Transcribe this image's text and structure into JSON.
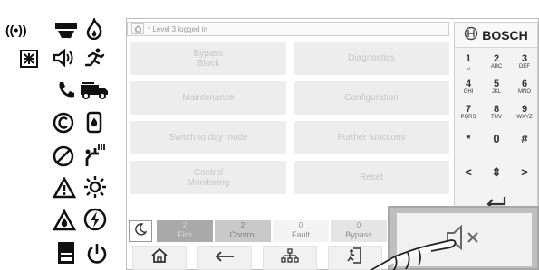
{
  "status_bar": {
    "text": "* Level 3 logged in"
  },
  "function_buttons": [
    {
      "label": "Bypass\nBlock",
      "name": "bypass-block-button"
    },
    {
      "label": "Diagnostics",
      "name": "diagnostics-button"
    },
    {
      "label": "Maintenance",
      "name": "maintenance-button"
    },
    {
      "label": "Configuration",
      "name": "configuration-button"
    },
    {
      "label": "Switch to day mode",
      "name": "switch-day-mode-button"
    },
    {
      "label": "Further functions",
      "name": "further-functions-button"
    },
    {
      "label": "Control\nMonitoring",
      "name": "control-monitoring-button"
    },
    {
      "label": "Reset",
      "name": "reset-button"
    }
  ],
  "brand": {
    "name": "BOSCH"
  },
  "keypad": {
    "keys": [
      {
        "digit": "1",
        "letters": "␣"
      },
      {
        "digit": "2",
        "letters": "ABC"
      },
      {
        "digit": "3",
        "letters": "DEF"
      },
      {
        "digit": "4",
        "letters": "GHI"
      },
      {
        "digit": "5",
        "letters": "JKL"
      },
      {
        "digit": "6",
        "letters": "MNO"
      },
      {
        "digit": "7",
        "letters": "PQRS"
      },
      {
        "digit": "8",
        "letters": "TUV"
      },
      {
        "digit": "9",
        "letters": "WXYZ"
      },
      {
        "digit": "*",
        "letters": ""
      },
      {
        "digit": "0",
        "letters": ""
      },
      {
        "digit": "#",
        "letters": ""
      }
    ],
    "nav": {
      "left": "<",
      "updown": "⇕",
      "right": ">"
    }
  },
  "tabs": {
    "fire": {
      "count": "2",
      "label": "Fire"
    },
    "control": {
      "count": "2",
      "label": "Control"
    },
    "fault": {
      "count": "0",
      "label": "Fault"
    },
    "bypass": {
      "count": "0",
      "label": "Bypass"
    }
  },
  "icons": {
    "indicators": [
      "radio-transmission-icon",
      "flashing-siren-icon",
      "fire-flame-icon",
      "alarm-box-icon",
      "speaker-icon",
      "running-person-icon",
      "phone-icon",
      "fire-truck-icon",
      "copyright-c-icon",
      "extinguisher-icon",
      "prohibited-icon",
      "sprinkler-icon",
      "warning-triangle-icon",
      "sun-icon",
      "fire-warning-triangle-icon",
      "lightning-icon",
      "printer-icon",
      "power-icon"
    ],
    "bottom_nav": [
      "home-icon",
      "back-arrow-icon",
      "network-icon",
      "logout-icon"
    ],
    "mute": "speaker-mute-icon"
  },
  "colors": {
    "accent": "#a9a9a9",
    "text_dim": "#c6c6c6",
    "border": "#bdbdbd"
  }
}
